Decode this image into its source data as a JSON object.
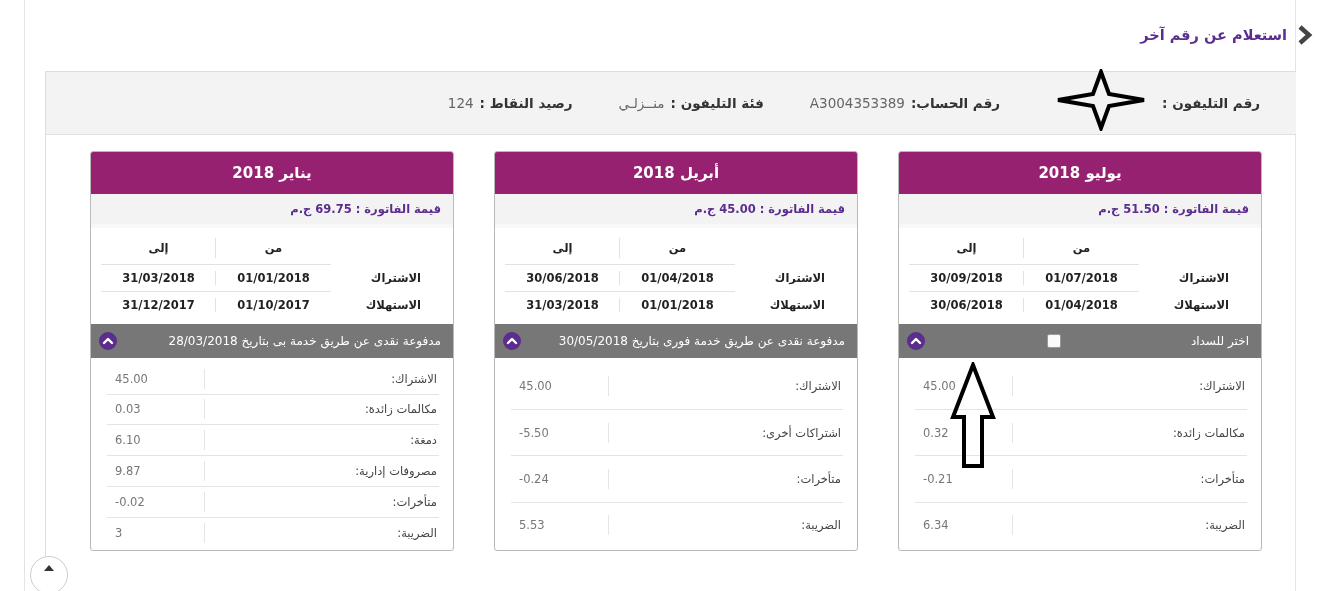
{
  "back_link": {
    "label": "استعلام عن رقم آخر"
  },
  "info_bar": [
    {
      "label": "رقم التليفون :"
    },
    {
      "label": "رقم الحساب:",
      "value": "A3004353389"
    },
    {
      "label": "فئة التليفون :",
      "value": "منــزلـي"
    },
    {
      "label": "رصيد النقاط :",
      "value": "124"
    }
  ],
  "bills": [
    {
      "month": "يوليو 2018",
      "amount": "قيمة الفاتورة : 51.50 ج.م",
      "period_columns": [
        "من",
        "إلى"
      ],
      "periods": [
        {
          "label": "الاشتراك",
          "from": "01/07/2018",
          "to": "30/09/2018"
        },
        {
          "label": "الاستهلاك",
          "from": "01/04/2018",
          "to": "30/06/2018"
        }
      ],
      "status": {
        "kind": "select",
        "label": "اختر للسداد",
        "checked": false
      },
      "expanded": true,
      "items": [
        {
          "label": "الاشتراك:",
          "value": "45.00"
        },
        {
          "label": "مكالمات زائدة:",
          "value": "0.32"
        },
        {
          "label": "متأخرات:",
          "value": "-0.21"
        },
        {
          "label": "الضريبة:",
          "value": "6.34"
        }
      ]
    },
    {
      "month": "أبريل 2018",
      "amount": "قيمة الفاتورة : 45.00 ج.م",
      "period_columns": [
        "من",
        "إلى"
      ],
      "periods": [
        {
          "label": "الاشتراك",
          "from": "01/04/2018",
          "to": "30/06/2018"
        },
        {
          "label": "الاستهلاك",
          "from": "01/01/2018",
          "to": "31/03/2018"
        }
      ],
      "status": {
        "kind": "paid",
        "label": "مدفوعة نقدى عن طريق خدمة فورى بتاريخ 30/05/2018"
      },
      "expanded": true,
      "items": [
        {
          "label": "الاشتراك:",
          "value": "45.00"
        },
        {
          "label": "اشتراكات أخرى:",
          "value": "-5.50"
        },
        {
          "label": "متأخرات:",
          "value": "-0.24"
        },
        {
          "label": "الضريبة:",
          "value": "5.53"
        }
      ]
    },
    {
      "month": "يناير 2018",
      "amount": "قيمة الفاتورة : 69.75 ج.م",
      "period_columns": [
        "من",
        "إلى"
      ],
      "periods": [
        {
          "label": "الاشتراك",
          "from": "01/01/2018",
          "to": "31/03/2018"
        },
        {
          "label": "الاستهلاك",
          "from": "01/10/2017",
          "to": "31/12/2017"
        }
      ],
      "status": {
        "kind": "paid",
        "label": "مدفوعة نقدى عن طريق خدمة بى بتاريخ 28/03/2018"
      },
      "expanded": true,
      "items": [
        {
          "label": "الاشتراك:",
          "value": "45.00"
        },
        {
          "label": "مكالمات زائدة:",
          "value": "0.03"
        },
        {
          "label": "دمغة:",
          "value": "6.10"
        },
        {
          "label": "مصروفات إدارية:",
          "value": "9.87"
        },
        {
          "label": "متأخرات:",
          "value": "-0.02"
        },
        {
          "label": "الضريبة:",
          "value": "3"
        }
      ]
    }
  ],
  "annotations": [
    {
      "kind": "star"
    },
    {
      "kind": "arrow"
    }
  ]
}
